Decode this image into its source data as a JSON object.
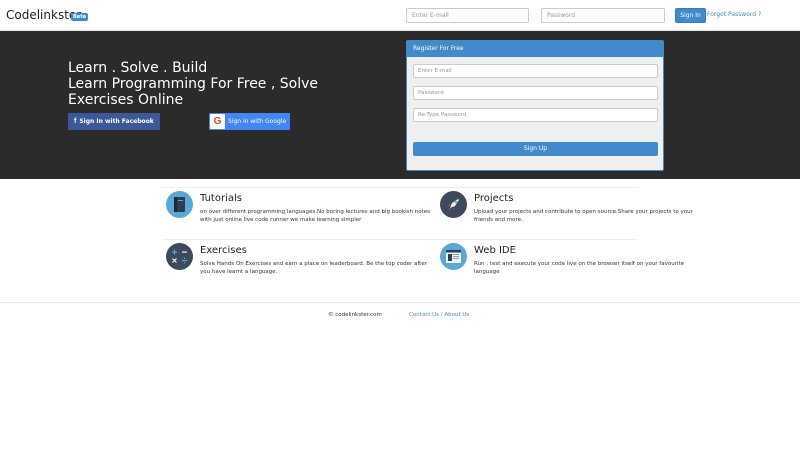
{
  "navbar": {
    "brand": "Codelinkster",
    "beta_badge": "Beta",
    "email_placeholder": "Enter E-mail",
    "password_placeholder": "Password",
    "signin_label": "Sign In",
    "forgot_label": "Forgot Password ?"
  },
  "hero": {
    "line1": "Learn . Solve . Build",
    "line2": "Learn Programming For Free , Solve",
    "line3": "Exercises Online",
    "facebook_label": "Sign In with Facebook",
    "google_label": "Sign in with Google",
    "facebook_icon_glyph": "f",
    "google_icon_glyph": "G"
  },
  "register": {
    "header": "Register For Free",
    "email_placeholder": "Enter E-mail",
    "password_placeholder": "Password",
    "retype_placeholder": "Re-Type Password",
    "signup_label": "Sign Up"
  },
  "features": [
    {
      "title": "Tutorials",
      "desc": "on over different programming languages.No boring lectures and big bookish notes with just online live code runner we make learning simpler",
      "icon": "book-icon",
      "color": "#5aa8d6"
    },
    {
      "title": "Projects",
      "desc": "Upload your projects and contribute to open source.Share your projects to your friends and more.",
      "icon": "rocket-icon",
      "color": "#3d4a5c"
    },
    {
      "title": "Exercises",
      "desc": "Solve Hands On Exercises and earn a place on leaderboard. Be the top coder after you have learnt a language.",
      "icon": "calculator-icon",
      "color": "#3d4a5c"
    },
    {
      "title": "Web IDE",
      "desc": "Run , test and execute your code live on the browser itself on your favourite language",
      "icon": "browser-window-icon",
      "color": "#5aa8d6"
    }
  ],
  "footer": {
    "copyright": "© codelinkster.com",
    "links": "Contact Us / About Us"
  },
  "colors": {
    "accent": "#428bca",
    "hero_bg": "#2b2b2b",
    "facebook": "#3b5998",
    "google": "#4285f4"
  }
}
